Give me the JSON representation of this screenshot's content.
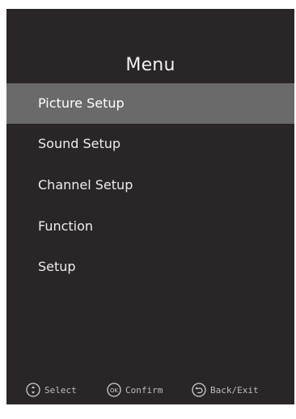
{
  "menu": {
    "title": "Menu",
    "items": [
      {
        "label": "Picture Setup",
        "selected": true
      },
      {
        "label": "Sound Setup",
        "selected": false
      },
      {
        "label": "Channel Setup",
        "selected": false
      },
      {
        "label": "Function",
        "selected": false
      },
      {
        "label": "Setup",
        "selected": false
      }
    ]
  },
  "footer": {
    "select_label": "Select",
    "confirm_label": "Confirm",
    "confirm_icon_text": "OK",
    "back_label": "Back/Exit",
    "icons": {
      "select": "up-down-arrows-icon",
      "confirm": "ok-button-icon",
      "back": "return-arrow-icon"
    }
  },
  "colors": {
    "background": "#2a2627",
    "highlight": "#6a6a6a",
    "text": "#ededed"
  }
}
